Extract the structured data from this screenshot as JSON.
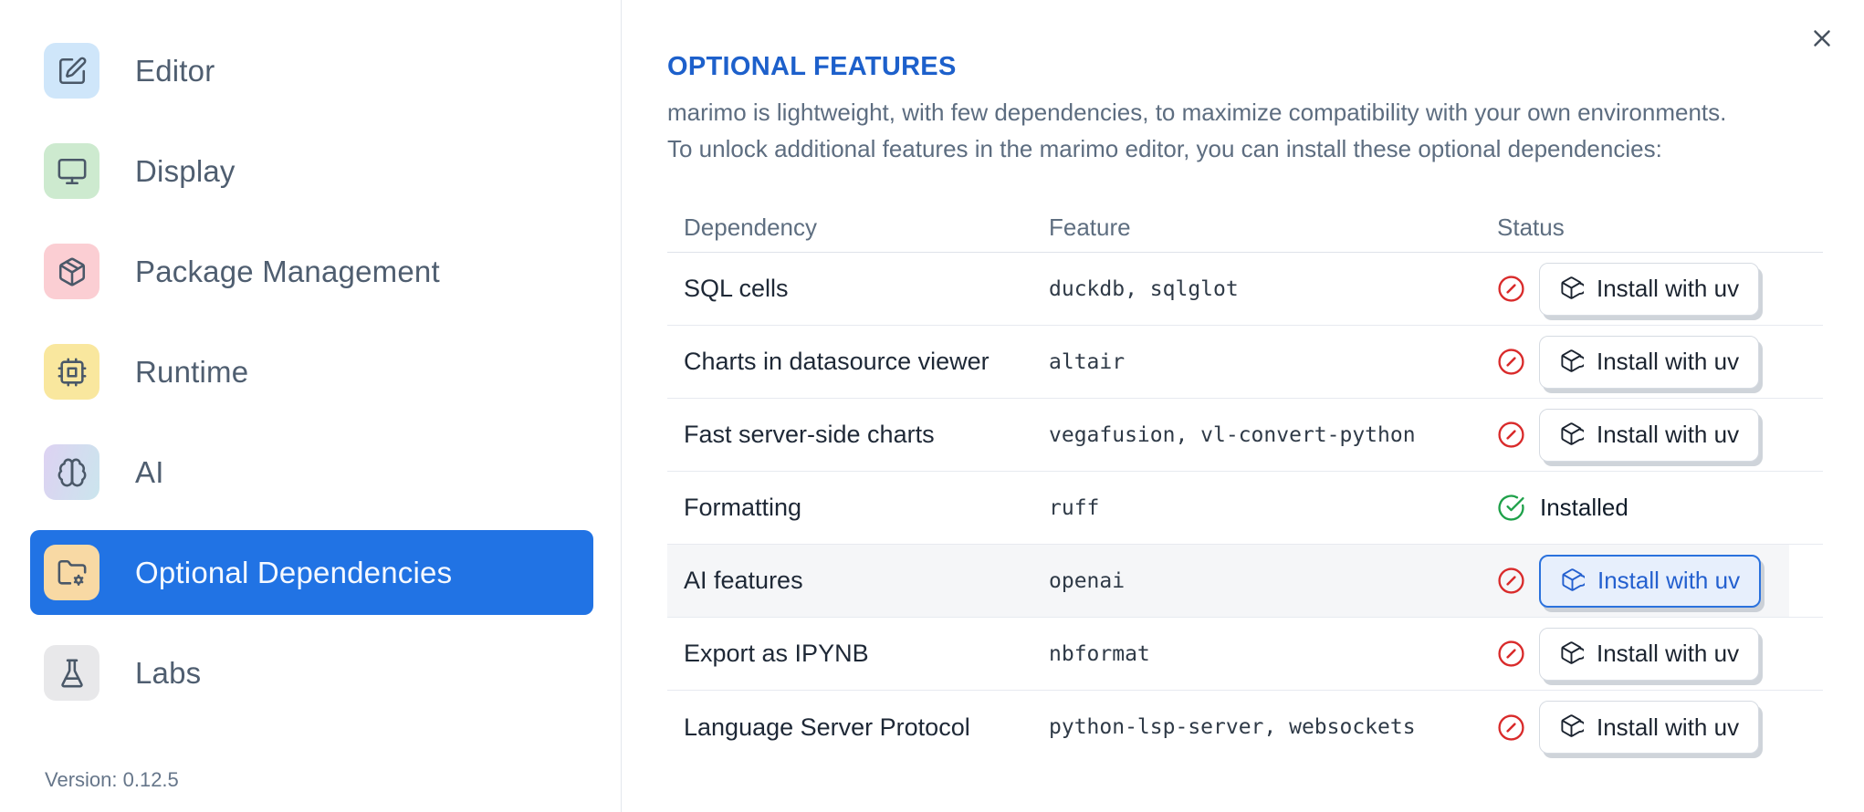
{
  "sidebar": {
    "items": [
      {
        "label": "Editor",
        "icon": "square-pen-icon",
        "tile_bg": "#cfe6fa"
      },
      {
        "label": "Display",
        "icon": "monitor-icon",
        "tile_bg": "#cdeacf"
      },
      {
        "label": "Package Management",
        "icon": "package-icon",
        "tile_bg": "#fbced3"
      },
      {
        "label": "Runtime",
        "icon": "cpu-icon",
        "tile_bg": "#f9e79e"
      },
      {
        "label": "AI",
        "icon": "brain-icon",
        "tile_bg": "#ddd2f2",
        "tile_bg2": "#cbe5ed"
      },
      {
        "label": "Optional Dependencies",
        "icon": "folder-cog-icon",
        "tile_bg": "#f8d9a4",
        "selected": true
      },
      {
        "label": "Labs",
        "icon": "flask-icon",
        "tile_bg": "#e8e8ea"
      }
    ],
    "version_label": "Version: 0.12.5"
  },
  "panel": {
    "title": "OPTIONAL FEATURES",
    "description_line1": "marimo is lightweight, with few dependencies, to maximize compatibility with your own environments.",
    "description_line2": "To unlock additional features in the marimo editor, you can install these optional dependencies:"
  },
  "table": {
    "headers": [
      "Dependency",
      "Feature",
      "Status"
    ],
    "install_button_label": "Install with uv",
    "installed_label": "Installed",
    "rows": [
      {
        "dependency": "SQL cells",
        "feature": "duckdb, sqlglot",
        "status": "not-installed"
      },
      {
        "dependency": "Charts in datasource viewer",
        "feature": "altair",
        "status": "not-installed"
      },
      {
        "dependency": "Fast server-side charts",
        "feature": "vegafusion, vl-convert-python",
        "status": "not-installed"
      },
      {
        "dependency": "Formatting",
        "feature": "ruff",
        "status": "installed"
      },
      {
        "dependency": "AI features",
        "feature": "openai",
        "status": "not-installed",
        "highlighted": true
      },
      {
        "dependency": "Export as IPYNB",
        "feature": "nbformat",
        "status": "not-installed"
      },
      {
        "dependency": "Language Server Protocol",
        "feature": "python-lsp-server, websockets",
        "status": "not-installed"
      }
    ]
  },
  "colors": {
    "accent_blue": "#2173e4",
    "title_blue": "#1d60cb",
    "error_red": "#d92b2b",
    "success_green": "#1fa14a"
  }
}
